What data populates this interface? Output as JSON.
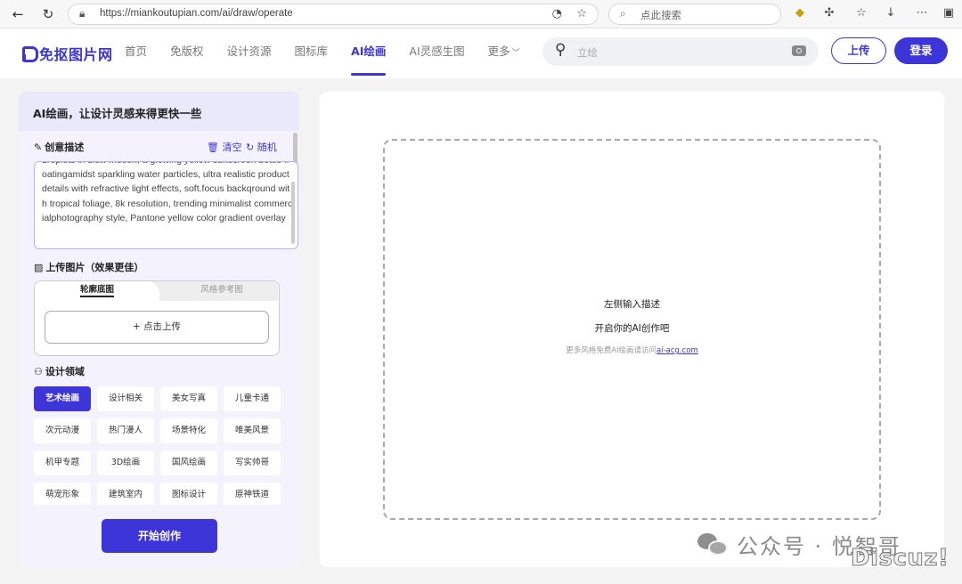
{
  "browser": {
    "url": "https://miankoutupian.com/ai/draw/operate",
    "search_placeholder": "点此搜索"
  },
  "site": {
    "logo_text": "免抠图片网",
    "nav": [
      {
        "label": "首页"
      },
      {
        "label": "免版权"
      },
      {
        "label": "设计资源"
      },
      {
        "label": "图标库"
      },
      {
        "label": "AI绘画",
        "active": true
      },
      {
        "label": "AI灵感生图"
      },
      {
        "label": "更多"
      }
    ],
    "search_placeholder": "立绘",
    "upload_label": "上传",
    "login_label": "登录",
    "accent_color": "#3d35d8"
  },
  "left_panel": {
    "title": "AI绘画，让设计灵感来得更快一些",
    "creative": {
      "label": "创意描述",
      "clear_label": "清空",
      "random_label": "随机",
      "text": "droplets in slow motion, a glowing yellow sunscreen bottle floatingamidst sparkling water particles, ultra realistic product details with refractive light effects, soft.focus backqround with tropical foliage, 8k resolution, trending minimalist commercialphotography style, Pantone yellow color gradient overlay"
    },
    "upload": {
      "label": "上传图片（效果更佳）",
      "tab_active": "轮廓底图",
      "tab_inactive": "风格参考图",
      "button_label": "+ 点击上传"
    },
    "domain": {
      "label": "设计领域",
      "tags": [
        "艺术绘画",
        "设计相关",
        "美女写真",
        "儿童卡通",
        "次元动漫",
        "热门漫人",
        "场景特化",
        "唯美风景",
        "机甲专题",
        "3D绘画",
        "国风绘画",
        "写实帅哥",
        "萌宠形象",
        "建筑室内",
        "图标设计",
        "原神铁道"
      ],
      "active_index": 0
    },
    "start_label": "开始创作"
  },
  "right_panel": {
    "line1": "左侧输入描述",
    "line2": "开启你的AI创作吧",
    "line3_prefix": "更多风格免费AI绘画请访问",
    "line3_link": "ai-acg.com"
  },
  "watermark": {
    "wechat_text": "公众号 · 悦智哥",
    "brand_text": "Discuz!"
  }
}
